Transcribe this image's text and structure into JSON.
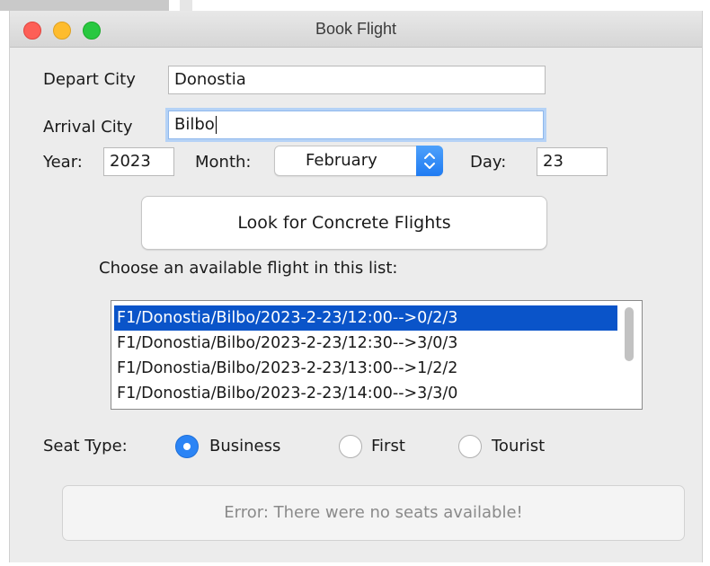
{
  "window": {
    "title": "Book Flight"
  },
  "form": {
    "depart_label": "Depart City",
    "depart_value": "Donostia",
    "arrival_label": "Arrival City",
    "arrival_value": "Bilbo",
    "year_label": "Year:",
    "year_value": "2023",
    "month_label": "Month:",
    "month_value": "February",
    "day_label": "Day:",
    "day_value": "23",
    "search_button": "Look for Concrete Flights",
    "list_prompt": "Choose an available flight in this list:"
  },
  "flights": [
    {
      "text": "F1/Donostia/Bilbo/2023-2-23/12:00-->0/2/3",
      "selected": true
    },
    {
      "text": "F1/Donostia/Bilbo/2023-2-23/12:30-->3/0/3",
      "selected": false
    },
    {
      "text": "F1/Donostia/Bilbo/2023-2-23/13:00-->1/2/2",
      "selected": false
    },
    {
      "text": "F1/Donostia/Bilbo/2023-2-23/14:00-->3/3/0",
      "selected": false
    }
  ],
  "seat": {
    "label": "Seat Type:",
    "options": [
      {
        "label": "Business",
        "selected": true
      },
      {
        "label": "First",
        "selected": false
      },
      {
        "label": "Tourist",
        "selected": false
      }
    ]
  },
  "status": {
    "message": "Error: There were no seats available!"
  },
  "colors": {
    "selection": "#0a54c9",
    "accent": "#2b84f5",
    "close": "#fd5f57",
    "minimize": "#febc2e",
    "maximize": "#28c840"
  }
}
